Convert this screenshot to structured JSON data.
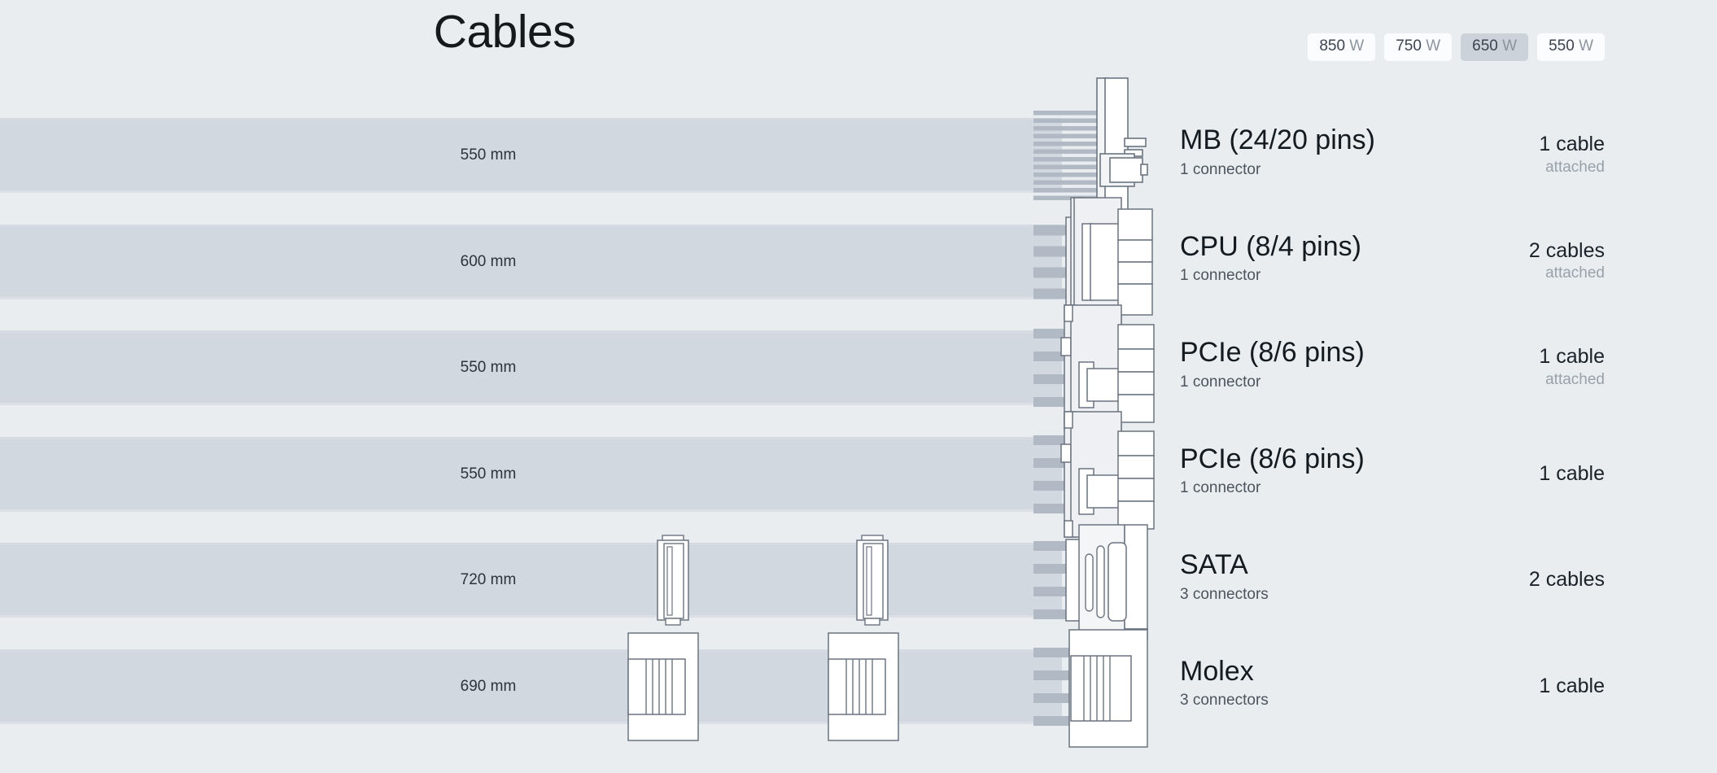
{
  "header": {
    "title": "Cables",
    "wattage_options": [
      {
        "value": "850",
        "unit": "W",
        "selected": false
      },
      {
        "value": "750",
        "unit": "W",
        "selected": false
      },
      {
        "value": "650",
        "unit": "W",
        "selected": true
      },
      {
        "value": "550",
        "unit": "W",
        "selected": false
      }
    ]
  },
  "colors": {
    "background": "#e9edf0",
    "cable_bar": "#d2d8e0",
    "wire_strip": "#b0b9c4",
    "connector_outline": "#6b7480",
    "connector_fill": "#ffffff",
    "selected_button": "#ccd2da",
    "button": "#fbfcfd",
    "title_text": "#16191c",
    "muted_text": "#9aa1aa"
  },
  "cables": [
    {
      "name": "MB (24/20 pins)",
      "connectors_text": "1 connector",
      "connector_count": 1,
      "length": "550 mm",
      "quantity": "1 cable",
      "attached": "attached",
      "is_attached": true,
      "end_connector_type": "mb",
      "inline_connectors": 0
    },
    {
      "name": "CPU (8/4 pins)",
      "connectors_text": "1 connector",
      "connector_count": 1,
      "length": "600 mm",
      "quantity": "2 cables",
      "attached": "attached",
      "is_attached": true,
      "end_connector_type": "cpu",
      "inline_connectors": 0
    },
    {
      "name": "PCIe (8/6 pins)",
      "connectors_text": "1 connector",
      "connector_count": 1,
      "length": "550 mm",
      "quantity": "1 cable",
      "attached": "attached",
      "is_attached": true,
      "end_connector_type": "pcie",
      "inline_connectors": 0
    },
    {
      "name": "PCIe (8/6 pins)",
      "connectors_text": "1 connector",
      "connector_count": 1,
      "length": "550 mm",
      "quantity": "1 cable",
      "attached": "",
      "is_attached": false,
      "end_connector_type": "pcie",
      "inline_connectors": 0
    },
    {
      "name": "SATA",
      "connectors_text": "3 connectors",
      "connector_count": 3,
      "length": "720 mm",
      "quantity": "2 cables",
      "attached": "",
      "is_attached": false,
      "end_connector_type": "sata",
      "inline_connectors": 2
    },
    {
      "name": "Molex",
      "connectors_text": "3 connectors",
      "connector_count": 3,
      "length": "690 mm",
      "quantity": "1 cable",
      "attached": "",
      "is_attached": false,
      "end_connector_type": "molex",
      "inline_connectors": 2
    }
  ]
}
